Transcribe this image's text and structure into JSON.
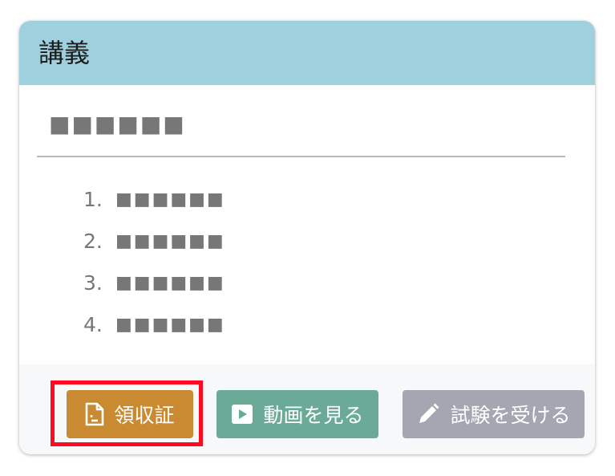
{
  "card": {
    "title": "講義",
    "lecture_title": "■■■■■■",
    "items": [
      {
        "number": "1.",
        "text": "■■■■■■"
      },
      {
        "number": "2.",
        "text": "■■■■■■"
      },
      {
        "number": "3.",
        "text": "■■■■■■"
      },
      {
        "number": "4.",
        "text": "■■■■■■"
      }
    ]
  },
  "footer": {
    "receipt_button": {
      "label": "領収証",
      "icon": "document-icon",
      "color": "#c98a32"
    },
    "video_button": {
      "label": "動画を見る",
      "icon": "play-icon",
      "color": "#6aaa97"
    },
    "exam_button": {
      "label": "試験を受ける",
      "icon": "pencil-icon",
      "color": "#a4a7b1"
    }
  },
  "colors": {
    "header_bg": "#9fd0dd",
    "highlight_border": "#ff0a1e"
  }
}
